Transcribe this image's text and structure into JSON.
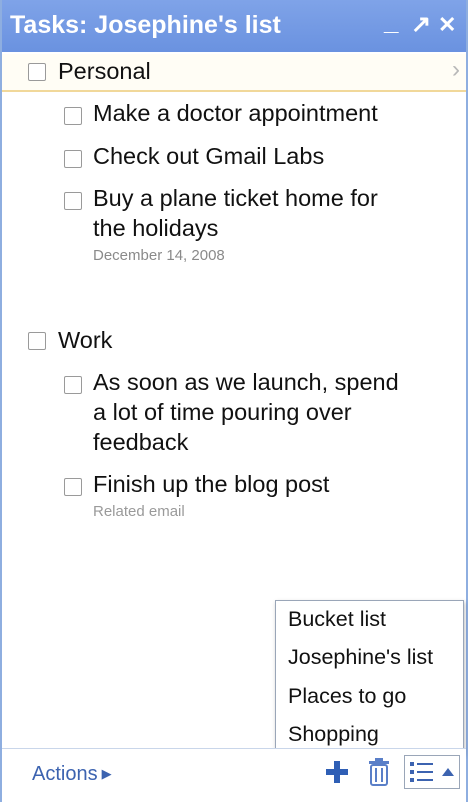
{
  "window": {
    "title": "Tasks: Josephine's list",
    "controls": [
      "_",
      "↗",
      "✕"
    ]
  },
  "lists": [
    {
      "name": "Personal",
      "tasks": [
        {
          "text": "Make a doctor appointment"
        },
        {
          "text": "Check out Gmail Labs"
        },
        {
          "text": "Buy a plane ticket home for the holidays",
          "line1": "Buy a plane ticket home for",
          "line2": "the holidays",
          "note": "December 14, 2008"
        }
      ]
    },
    {
      "name": "Work",
      "tasks": [
        {
          "text": "As soon as we launch, spend a lot of time pouring over feedback",
          "line1": "As soon as we launch, spend",
          "line2": "a lot of time pouring over",
          "line3": "feedback"
        },
        {
          "text": "Finish up the blog post",
          "note": "Related email"
        }
      ]
    }
  ],
  "list_menu": {
    "items": [
      "Bucket list",
      "Josephine's list",
      "Places to go",
      "Shopping"
    ]
  },
  "footer": {
    "actions_label": "Actions",
    "icons": [
      "add-task-icon",
      "delete-icon",
      "switch-list-icon"
    ]
  },
  "colors": {
    "titlebar": "#7fa3e8",
    "link": "#3c63b0"
  }
}
